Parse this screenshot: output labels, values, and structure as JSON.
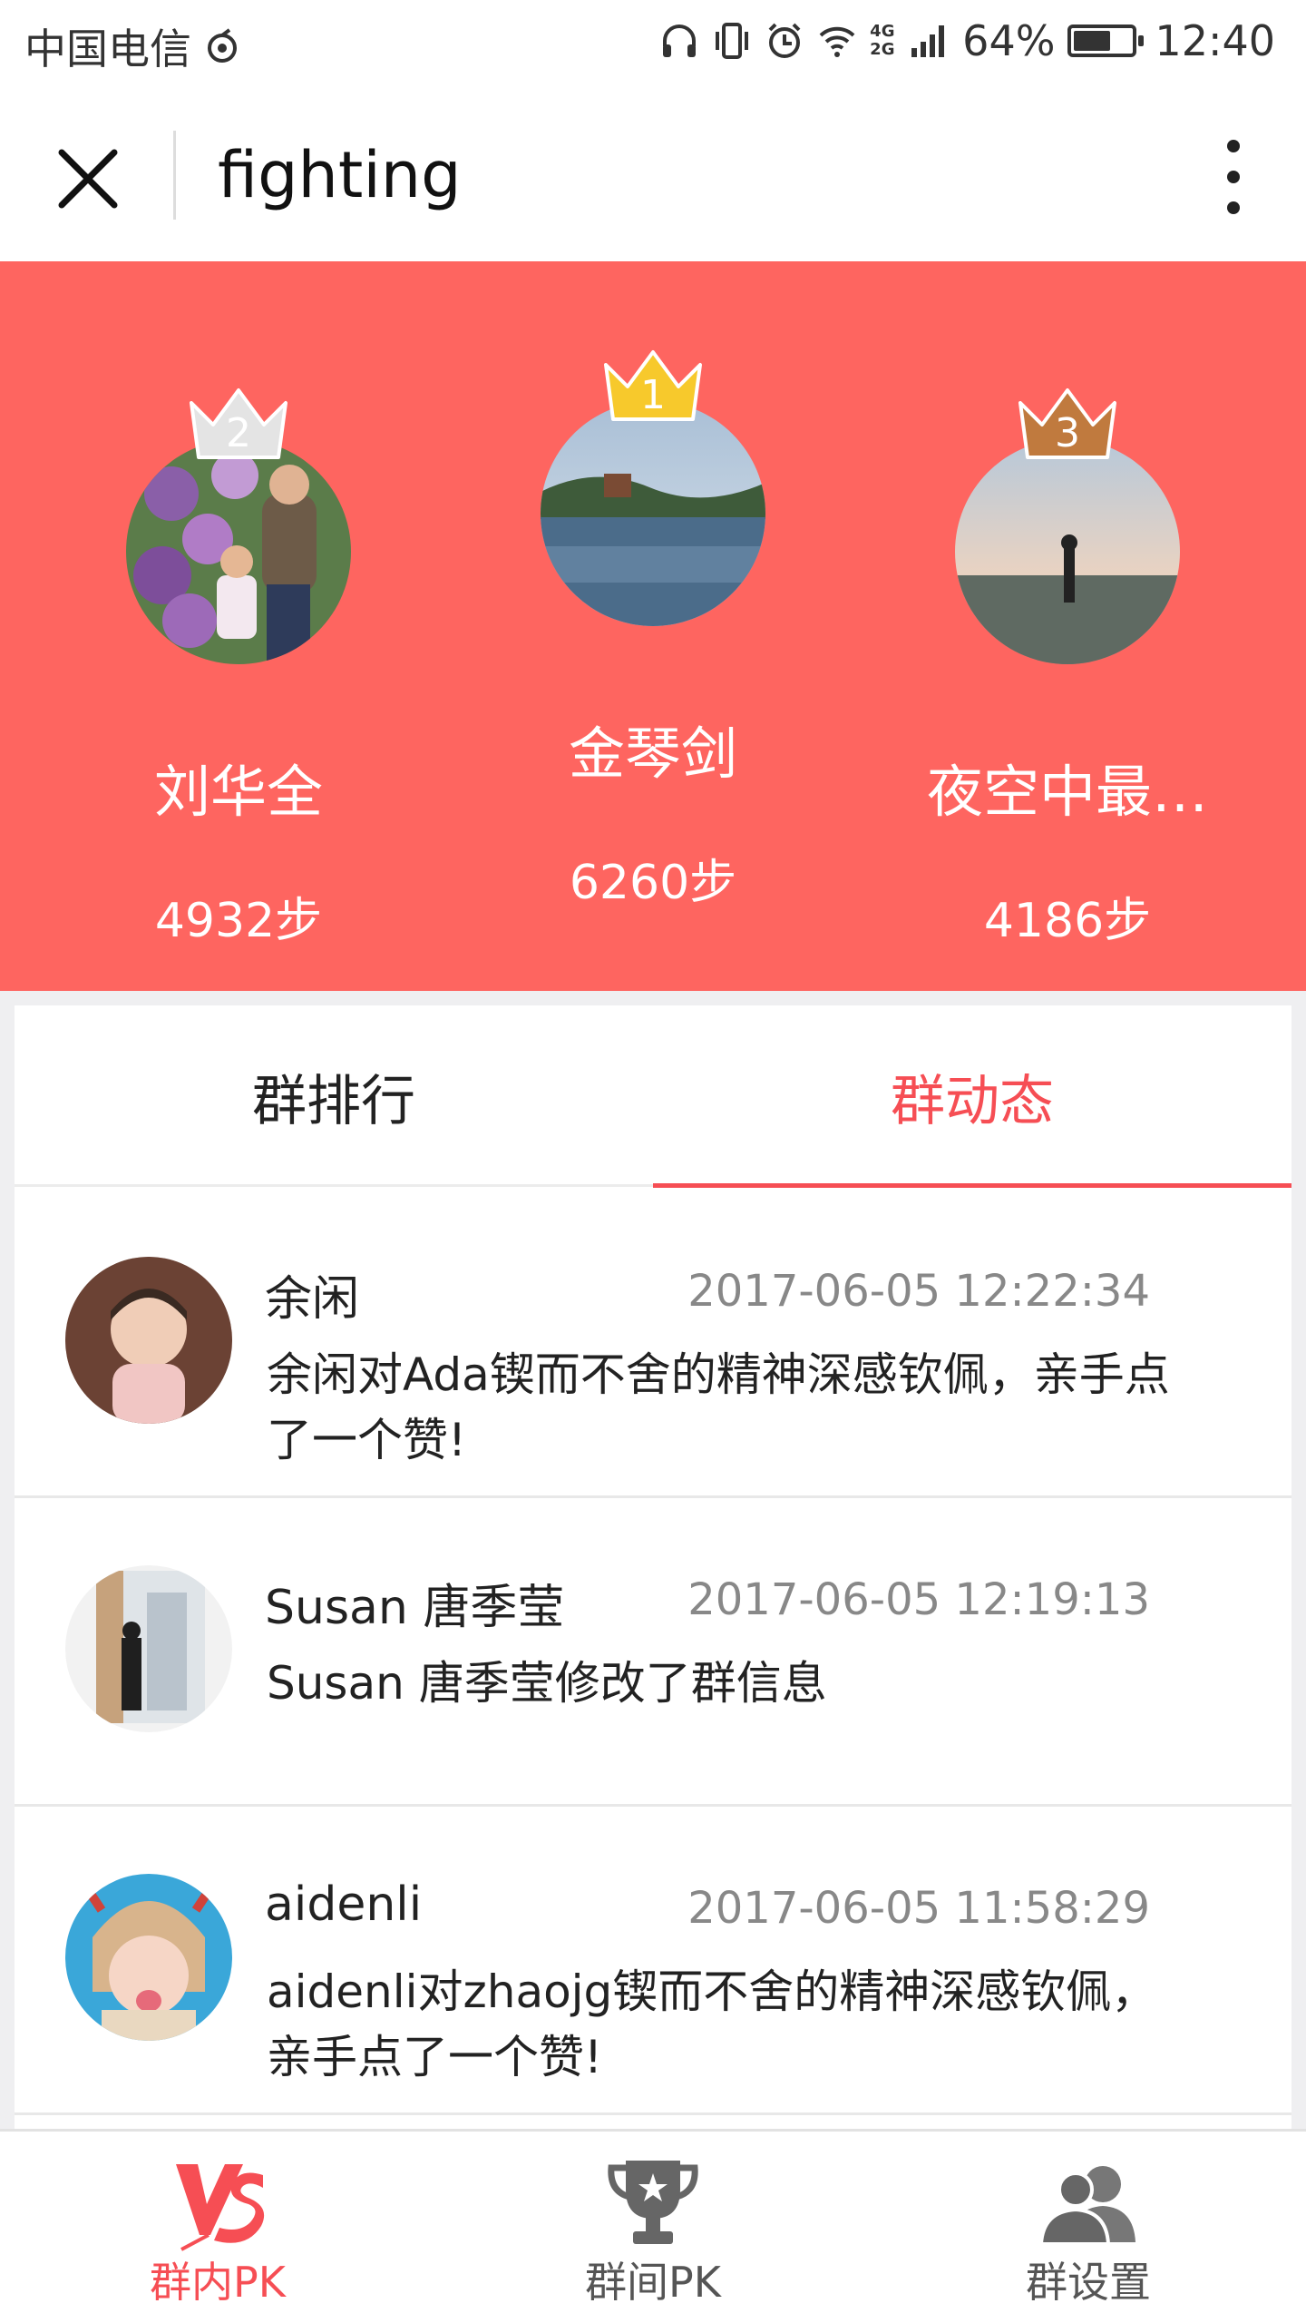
{
  "status_bar": {
    "carrier": "中国电信",
    "signal": "4G 2G",
    "battery": "64%",
    "battery_level": 0.64,
    "time": "12:40"
  },
  "header": {
    "title": "fighting"
  },
  "podium": [
    {
      "rank": "2",
      "name": "刘华全",
      "steps": "4932步",
      "crown_color": "#e4e4e4"
    },
    {
      "rank": "1",
      "name": "金琴剑",
      "steps": "6260步",
      "crown_color": "#f7c92c"
    },
    {
      "rank": "3",
      "name": "夜空中最…",
      "steps": "4186步",
      "crown_color": "#c07a3e"
    }
  ],
  "tabs": [
    {
      "label": "群排行",
      "active": false
    },
    {
      "label": "群动态",
      "active": true
    }
  ],
  "feed": [
    {
      "name": "余闲",
      "time": "2017-06-05 12:22:34",
      "text": "余闲对Ada锲而不舍的精神深感钦佩，亲手点了一个赞!"
    },
    {
      "name": "Susan 唐季莹",
      "time": "2017-06-05 12:19:13",
      "text": "Susan 唐季莹修改了群信息"
    },
    {
      "name": "aidenli",
      "time": "2017-06-05 11:58:29",
      "text": "aidenli对zhaojg锲而不舍的精神深感钦佩，亲手点了一个赞!"
    }
  ],
  "bottom_nav": [
    {
      "label": "群内PK",
      "icon": "vs-icon",
      "active": true
    },
    {
      "label": "群间PK",
      "icon": "trophy-icon",
      "active": false
    },
    {
      "label": "群设置",
      "icon": "group-users-icon",
      "active": false
    }
  ],
  "colors": {
    "brand_red": "#fe6560",
    "accent": "#f64e54"
  }
}
